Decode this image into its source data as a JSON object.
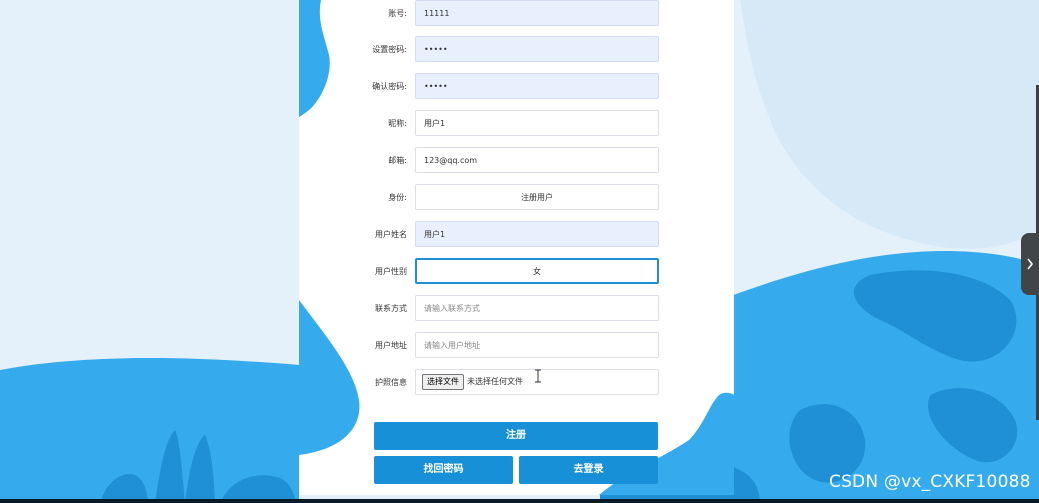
{
  "form": {
    "fields": [
      {
        "label": "账号:",
        "value": "11111"
      },
      {
        "label": "设置密码:",
        "value": "•••••"
      },
      {
        "label": "确认密码:",
        "value": "•••••"
      },
      {
        "label": "昵称:",
        "value": "用户1"
      },
      {
        "label": "邮箱:",
        "value": "123@qq.com"
      },
      {
        "label": "身份:",
        "value": "注册用户"
      },
      {
        "label": "用户姓名",
        "value": "用户1"
      },
      {
        "label": "用户性别",
        "value": "女"
      },
      {
        "label": "联系方式",
        "placeholder": "请输入联系方式"
      },
      {
        "label": "用户地址",
        "placeholder": "请输入用户地址"
      },
      {
        "label": "护照信息",
        "file_button": "选择文件",
        "file_status": "未选择任何文件"
      }
    ],
    "register_button": "注册",
    "recover_button": "找回密码",
    "login_button": "去登录"
  },
  "watermark": "CSDN @vx_CXKF10088",
  "colors": {
    "accent": "#1890d8",
    "bg_light": "#e4f1fb",
    "bg_blue": "#33aaee",
    "bg_dark_blue": "#1a8ad4",
    "filled_field": "#e8f0fe"
  }
}
